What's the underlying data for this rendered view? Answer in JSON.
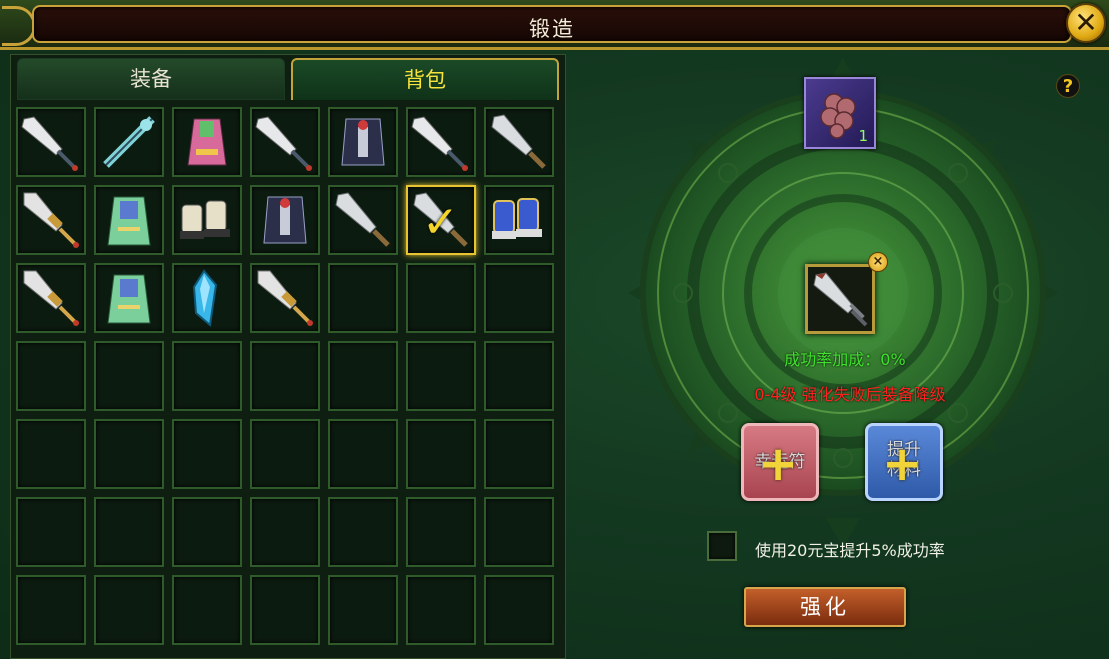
{
  "window": {
    "title": "锻造",
    "close_icon": "close-icon"
  },
  "tabs": [
    {
      "label": "装备",
      "active": false
    },
    {
      "label": "背包",
      "active": true
    }
  ],
  "inventory": {
    "slots": [
      {
        "icon": "dagger-icon"
      },
      {
        "icon": "ornate-staff-icon"
      },
      {
        "icon": "pink-robe-icon"
      },
      {
        "icon": "dagger-icon"
      },
      {
        "icon": "dark-armor-icon"
      },
      {
        "icon": "dagger-icon"
      },
      {
        "icon": "sword-icon"
      },
      {
        "icon": "golden-sword-icon"
      },
      {
        "icon": "green-robe-icon"
      },
      {
        "icon": "boots-icon"
      },
      {
        "icon": "dark-armor-icon"
      },
      {
        "icon": "sword-icon"
      },
      {
        "icon": "sword-icon",
        "selected": true
      },
      {
        "icon": "blue-boots-icon"
      },
      {
        "icon": "golden-sword-icon"
      },
      {
        "icon": "green-robe-icon"
      },
      {
        "icon": "crystal-icon"
      },
      {
        "icon": "golden-sword-icon"
      },
      {},
      {},
      {},
      {},
      {},
      {},
      {},
      {},
      {},
      {},
      {},
      {},
      {},
      {},
      {},
      {},
      {},
      {},
      {},
      {},
      {},
      {},
      {},
      {},
      {},
      {},
      {},
      {},
      {},
      {},
      {}
    ]
  },
  "forge": {
    "help_icon": "?",
    "material": {
      "icon": "ore-icon",
      "count": "1"
    },
    "target": {
      "icon": "sword-icon",
      "remove_icon": "×"
    },
    "success_bonus": "成功率加成：0%",
    "warning": "0-4级 强化失败后装备降级",
    "luck_slot": {
      "label": "幸运符",
      "plus": "+"
    },
    "upgrade_material_slot": {
      "label_line1": "提升",
      "label_line2": "材料",
      "plus": "+"
    },
    "option_label": "使用20元宝提升5%成功率",
    "option_checked": false,
    "strengthen_button": "强化"
  }
}
